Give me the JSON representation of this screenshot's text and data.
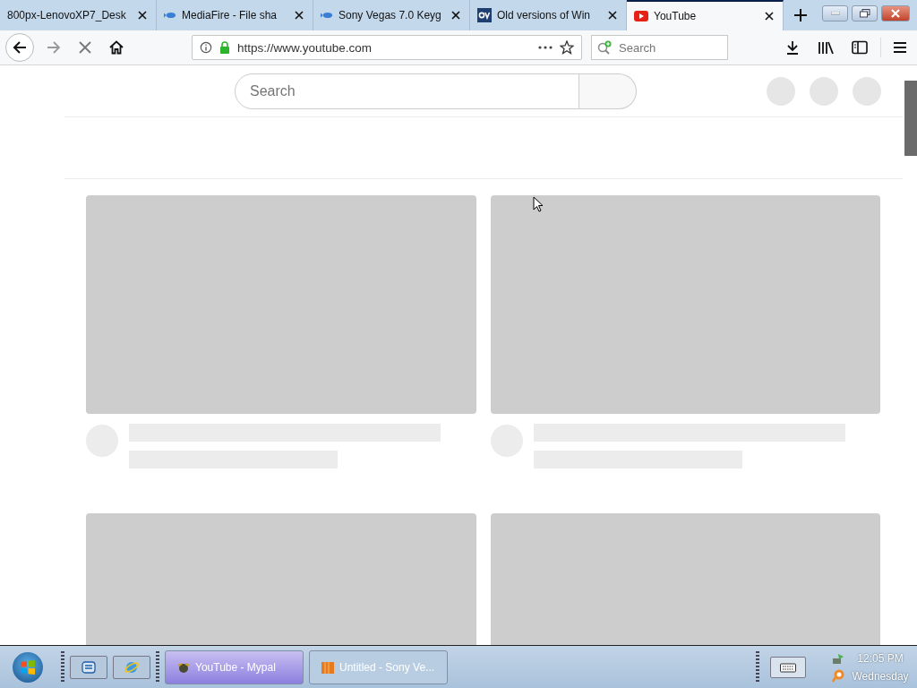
{
  "tabs": [
    {
      "title": "800px-LenovoXP7_Desk",
      "selected": false
    },
    {
      "title": "MediaFire - File sha",
      "selected": false
    },
    {
      "title": "Sony Vegas 7.0 Keyg",
      "selected": false
    },
    {
      "title": "Old versions of Win",
      "selected": false
    },
    {
      "title": "YouTube",
      "selected": true
    }
  ],
  "toolbar": {
    "loading": true,
    "url": "https://www.youtube.com",
    "search_placeholder": "Search"
  },
  "page": {
    "search_placeholder": "Search"
  },
  "taskbar": {
    "tasks": [
      {
        "title": "YouTube - Mypal",
        "selected": true
      },
      {
        "title": "Untitled - Sony Ve...",
        "selected": false
      }
    ],
    "time": "12:05 PM",
    "day": "Wednesday"
  }
}
